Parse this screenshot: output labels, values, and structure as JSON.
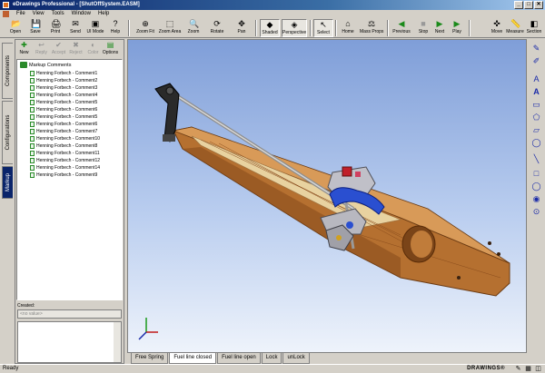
{
  "window": {
    "title": "eDrawings Professional - [ShutOffSystem.EASM]",
    "controls": [
      "_",
      "□",
      "✕"
    ]
  },
  "menu": [
    "File",
    "View",
    "Tools",
    "Window",
    "Help"
  ],
  "toolbar": [
    {
      "label": "Open",
      "icon": "📂"
    },
    {
      "label": "Save",
      "icon": "💾"
    },
    {
      "label": "Print",
      "icon": "🖨"
    },
    {
      "label": "Send",
      "icon": "✉"
    },
    {
      "label": "UI Mode",
      "icon": "▣"
    },
    {
      "label": "Help",
      "icon": "?"
    },
    {
      "label": "Zoom Fit",
      "icon": "⊕"
    },
    {
      "label": "Zoom Area",
      "icon": "⬚"
    },
    {
      "label": "Zoom",
      "icon": "🔍"
    },
    {
      "label": "Rotate",
      "icon": "⟳"
    },
    {
      "label": "Pan",
      "icon": "✥"
    },
    {
      "label": "Shaded",
      "icon": "◆"
    },
    {
      "label": "Perspective",
      "icon": "◈"
    },
    {
      "label": "Select",
      "icon": "↖"
    },
    {
      "label": "Home",
      "icon": "⌂"
    },
    {
      "label": "Mass Props",
      "icon": "⚖"
    },
    {
      "label": "Previous",
      "icon": "◀"
    },
    {
      "label": "Stop",
      "icon": "■"
    },
    {
      "label": "Next",
      "icon": "▶"
    },
    {
      "label": "Play",
      "icon": "▶"
    },
    {
      "label": "Move",
      "icon": "✜"
    },
    {
      "label": "Measure",
      "icon": "📏"
    },
    {
      "label": "Section",
      "icon": "◧"
    }
  ],
  "side_tabs": [
    "Components",
    "Configurations",
    "Markup"
  ],
  "panel": {
    "buttons": [
      {
        "label": "New",
        "icon": "✚",
        "enabled": true
      },
      {
        "label": "Reply",
        "icon": "↩",
        "enabled": false
      },
      {
        "label": "Accept",
        "icon": "✔",
        "enabled": false
      },
      {
        "label": "Reject",
        "icon": "✖",
        "enabled": false
      },
      {
        "label": "Color",
        "icon": "◐",
        "enabled": false
      },
      {
        "label": "Options",
        "icon": "▤",
        "enabled": true
      }
    ],
    "tree_root": "Markup Comments",
    "comments": [
      "Henning Forbech - Comment1",
      "Henning Forbech - Comment2",
      "Henning Forbech - Comment3",
      "Henning Forbech - Comment4",
      "Henning Forbech - Comment5",
      "Henning Forbech - Comment6",
      "Henning Forbech - Comment5",
      "Henning Forbech - Comment6",
      "Henning Forbech - Comment7",
      "Henning Forbech - Comment10",
      "Henning Forbech - Comment8",
      "Henning Forbech - Comment11",
      "Henning Forbech - Comment12",
      "Henning Forbech - Comment14",
      "Henning Forbech - Comment9"
    ],
    "created_label": "Created:",
    "created_value": "<no value>"
  },
  "bottom_tabs": [
    "Free Spring",
    "Fuel line closed",
    "Fuel line open",
    "Lock",
    "unLock"
  ],
  "active_bottom_tab": 1,
  "right_tools": [
    "✎",
    "✐",
    "A",
    "A",
    "▭",
    "⬠",
    "▱",
    "◯",
    "╲",
    "□",
    "◯",
    "◉",
    "⊙"
  ],
  "status": {
    "text": "Ready",
    "brand": "DRAWINGS®"
  },
  "colors": {
    "title_bar": "#0a246a",
    "viewport_top": "#7f9ed8",
    "viewport_bottom": "#eef3fb",
    "wood": "#a5632b",
    "clamp": "#2a4fd0"
  }
}
